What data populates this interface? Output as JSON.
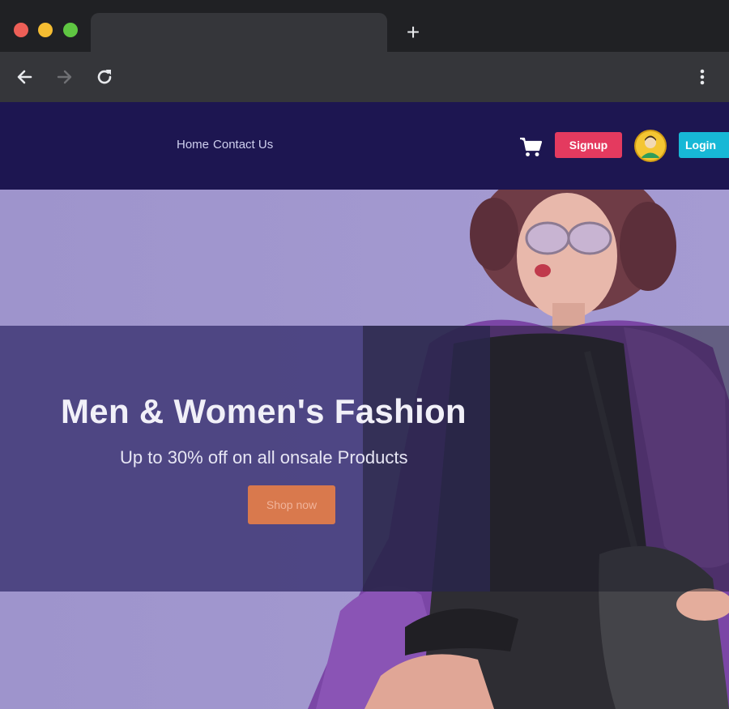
{
  "browser": {
    "tab_title": "",
    "new_tab_symbol": "+",
    "toolbar_icons": [
      "back-arrow-icon",
      "forward-arrow-icon",
      "reload-icon",
      "kebab-menu-icon"
    ]
  },
  "nav": {
    "links": [
      "Home",
      "Contact Us"
    ],
    "cart_icon": "cart-icon",
    "signup_label": "Signup",
    "avatar_icon": "user-avatar-icon",
    "login_label": "Login"
  },
  "hero": {
    "title": "Men & Women's Fashion",
    "subtitle": "Up to 30% off on all onsale Products",
    "cta_label": "Shop now"
  },
  "colors": {
    "nav_bg": "#1d1651",
    "hero_bg": "#9c92c9",
    "signup": "#e43a5f",
    "login": "#17b8d6",
    "cta": "#d9794d"
  }
}
